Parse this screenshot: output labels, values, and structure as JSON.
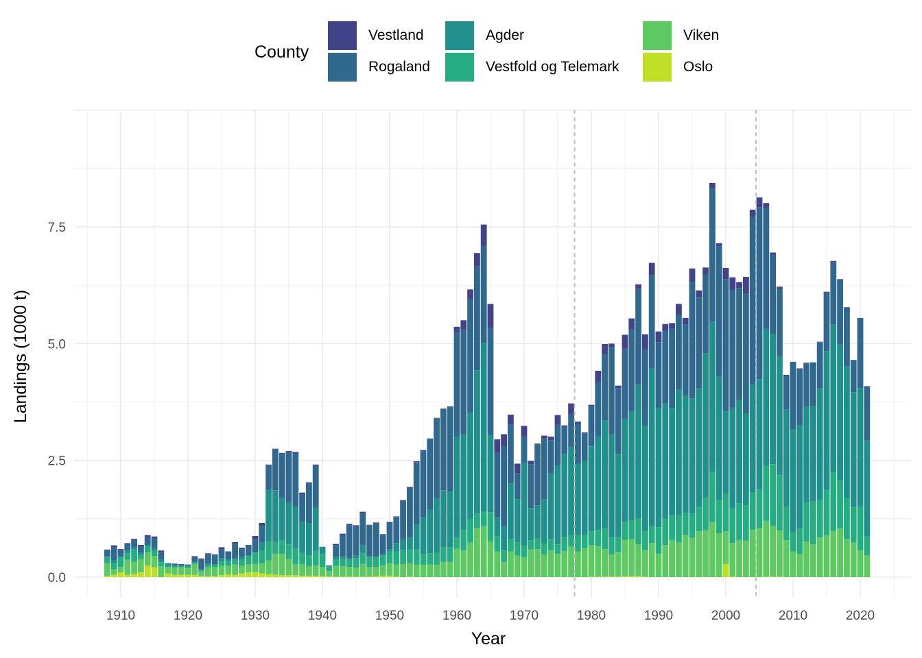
{
  "chart_data": {
    "type": "bar",
    "stacked": true,
    "title": "",
    "xlabel": "Year",
    "ylabel": "Landings (1000 t)",
    "ylim": [
      -0.35,
      9.6
    ],
    "xlim": [
      1903,
      2027
    ],
    "yticks": [
      0.0,
      2.5,
      5.0,
      7.5
    ],
    "ytick_labels": [
      "0.0",
      "2.5",
      "5.0",
      "7.5"
    ],
    "xticks": [
      1910,
      1920,
      1930,
      1940,
      1950,
      1960,
      1970,
      1980,
      1990,
      2000,
      2010,
      2020
    ],
    "xtick_labels": [
      "1910",
      "1920",
      "1930",
      "1940",
      "1950",
      "1960",
      "1970",
      "1980",
      "1990",
      "2000",
      "2010",
      "2020"
    ],
    "grid": true,
    "vlines": [
      1977.5,
      2004.5
    ],
    "legend": {
      "title": "County",
      "position": "top"
    },
    "series_order_bottom_to_top": [
      "Oslo",
      "Viken",
      "Vestfold og Telemark",
      "Agder",
      "Rogaland",
      "Vestland"
    ],
    "colors": {
      "Vestland": "#414487",
      "Rogaland": "#31688e",
      "Agder": "#21908c",
      "Vestfold og Telemark": "#27ad81",
      "Viken": "#5ec962",
      "Oslo": "#bddf26"
    },
    "x": [
      1908,
      1909,
      1910,
      1911,
      1912,
      1913,
      1914,
      1915,
      1916,
      1917,
      1918,
      1919,
      1920,
      1921,
      1922,
      1923,
      1924,
      1925,
      1926,
      1927,
      1928,
      1929,
      1930,
      1931,
      1932,
      1933,
      1934,
      1935,
      1936,
      1937,
      1938,
      1939,
      1940,
      1941,
      1942,
      1943,
      1944,
      1945,
      1946,
      1947,
      1948,
      1949,
      1950,
      1951,
      1952,
      1953,
      1954,
      1955,
      1956,
      1957,
      1958,
      1959,
      1960,
      1961,
      1962,
      1963,
      1964,
      1965,
      1966,
      1967,
      1968,
      1969,
      1970,
      1971,
      1972,
      1973,
      1974,
      1975,
      1976,
      1977,
      1978,
      1979,
      1980,
      1981,
      1982,
      1983,
      1984,
      1985,
      1986,
      1987,
      1988,
      1989,
      1990,
      1991,
      1992,
      1993,
      1994,
      1995,
      1996,
      1997,
      1998,
      1999,
      2000,
      2001,
      2002,
      2003,
      2004,
      2005,
      2006,
      2007,
      2008,
      2009,
      2010,
      2011,
      2012,
      2013,
      2014,
      2015,
      2016,
      2017,
      2018,
      2019,
      2020,
      2021
    ],
    "series": [
      {
        "name": "Oslo",
        "values": [
          0.03,
          0.05,
          0.1,
          0.05,
          0.07,
          0.1,
          0.25,
          0.21,
          0.0,
          0.08,
          0.05,
          0.05,
          0.05,
          0.05,
          0.02,
          0.02,
          0.02,
          0.04,
          0.06,
          0.05,
          0.08,
          0.1,
          0.1,
          0.08,
          0.06,
          0.05,
          0.04,
          0.04,
          0.04,
          0.03,
          0.03,
          0.03,
          0.02,
          0.02,
          0.01,
          0.01,
          0.01,
          0.01,
          0.01,
          0.01,
          0.02,
          0.03,
          0.03,
          0.01,
          0.0,
          0.01,
          0.0,
          0.0,
          0.0,
          0.0,
          0.0,
          0.0,
          0.0,
          0.0,
          0.0,
          0.0,
          0.0,
          0.0,
          0.0,
          0.0,
          0.0,
          0.0,
          0.0,
          0.0,
          0.0,
          0.0,
          0.0,
          0.0,
          0.0,
          0.0,
          0.0,
          0.0,
          0.01,
          0.01,
          0.01,
          0.01,
          0.01,
          0.02,
          0.02,
          0.02,
          0.01,
          0.0,
          0.0,
          0.0,
          0.0,
          0.0,
          0.0,
          0.0,
          0.0,
          0.0,
          0.0,
          0.0,
          0.28,
          0.01,
          0.0,
          0.0,
          0.0,
          0.0,
          0.01,
          0.01,
          0.01,
          0.0,
          0.0,
          0.0,
          0.0,
          0.0,
          0.0,
          0.0,
          0.0,
          0.0,
          0.0,
          0.0,
          0.0,
          0.0
        ]
      },
      {
        "name": "Viken",
        "values": [
          0.27,
          0.12,
          0.12,
          0.32,
          0.26,
          0.29,
          0.28,
          0.24,
          0.23,
          0.14,
          0.15,
          0.16,
          0.14,
          0.23,
          0.1,
          0.19,
          0.2,
          0.2,
          0.18,
          0.22,
          0.16,
          0.17,
          0.18,
          0.22,
          0.3,
          0.45,
          0.46,
          0.35,
          0.23,
          0.25,
          0.2,
          0.22,
          0.2,
          0.11,
          0.23,
          0.22,
          0.21,
          0.19,
          0.27,
          0.2,
          0.2,
          0.22,
          0.27,
          0.26,
          0.28,
          0.29,
          0.27,
          0.26,
          0.27,
          0.26,
          0.33,
          0.33,
          0.61,
          0.57,
          0.74,
          1.05,
          1.09,
          0.76,
          0.55,
          0.33,
          0.55,
          0.46,
          0.42,
          0.59,
          0.6,
          0.48,
          0.57,
          0.5,
          0.56,
          0.65,
          0.55,
          0.62,
          0.67,
          0.65,
          0.59,
          0.47,
          0.53,
          0.78,
          0.79,
          0.68,
          0.56,
          0.73,
          0.5,
          0.69,
          0.8,
          0.75,
          0.9,
          0.84,
          0.98,
          1.0,
          1.18,
          0.94,
          0.7,
          0.72,
          0.8,
          0.78,
          1.02,
          1.05,
          1.2,
          1.08,
          0.99,
          0.79,
          0.55,
          0.49,
          0.76,
          0.7,
          0.85,
          0.89,
          0.99,
          1.04,
          0.82,
          0.74,
          0.58,
          0.47
        ]
      },
      {
        "name": "Vestfold og Telemark",
        "values": [
          0.12,
          0.12,
          0.22,
          0.14,
          0.26,
          0.09,
          0.13,
          0.11,
          0.09,
          0.03,
          0.04,
          0.03,
          0.05,
          0.03,
          0.03,
          0.05,
          0.05,
          0.1,
          0.11,
          0.1,
          0.13,
          0.18,
          0.24,
          0.26,
          0.4,
          0.25,
          0.3,
          0.31,
          0.35,
          0.24,
          0.23,
          0.31,
          0.28,
          0.08,
          0.13,
          0.16,
          0.15,
          0.2,
          0.24,
          0.21,
          0.2,
          0.21,
          0.25,
          0.28,
          0.29,
          0.29,
          0.32,
          0.23,
          0.24,
          0.26,
          0.31,
          0.31,
          0.24,
          0.45,
          0.5,
          0.31,
          0.31,
          0.63,
          0.33,
          0.24,
          0.26,
          0.29,
          0.23,
          0.2,
          0.23,
          0.23,
          0.25,
          0.2,
          0.29,
          0.24,
          0.35,
          0.28,
          0.3,
          0.35,
          0.45,
          0.37,
          0.32,
          0.38,
          0.4,
          0.55,
          0.42,
          0.36,
          0.57,
          0.56,
          0.53,
          0.57,
          0.48,
          0.52,
          0.52,
          0.71,
          1.08,
          0.7,
          0.8,
          0.74,
          0.78,
          0.75,
          0.8,
          0.83,
          1.17,
          1.33,
          1.19,
          0.72,
          0.41,
          0.54,
          0.84,
          0.92,
          0.8,
          0.98,
          1.25,
          1.02,
          0.87,
          0.76,
          0.93,
          0.4
        ]
      },
      {
        "name": "Agder",
        "values": [
          0.03,
          0.07,
          0.0,
          0.06,
          0.05,
          0.04,
          0.03,
          0.05,
          0.05,
          0.05,
          0.01,
          0.0,
          0.0,
          0.02,
          0.02,
          0.03,
          0.0,
          0.07,
          0.04,
          0.03,
          0.06,
          0.02,
          0.02,
          0.18,
          1.11,
          1.11,
          0.89,
          0.89,
          0.89,
          0.67,
          0.69,
          0.93,
          0.15,
          0.02,
          0.07,
          0.06,
          0.03,
          0.06,
          0.16,
          0.03,
          0.02,
          0.03,
          0.05,
          0.18,
          0.24,
          0.26,
          0.53,
          0.79,
          0.93,
          1.17,
          1.22,
          1.2,
          2.15,
          2.04,
          2.28,
          3.07,
          3.61,
          1.65,
          0.4,
          0.52,
          1.2,
          0.92,
          1.8,
          0.69,
          0.71,
          0.96,
          1.4,
          1.7,
          1.78,
          1.9,
          1.53,
          1.59,
          1.82,
          2.0,
          2.31,
          2.21,
          1.78,
          2.21,
          2.33,
          2.87,
          2.25,
          3.38,
          2.55,
          2.47,
          2.29,
          2.69,
          2.5,
          2.47,
          2.54,
          3.08,
          3.21,
          2.66,
          1.77,
          2.14,
          2.21,
          1.97,
          2.3,
          2.36,
          2.94,
          2.79,
          2.53,
          2.08,
          2.21,
          2.22,
          2.05,
          2.04,
          2.4,
          2.97,
          3.17,
          2.93,
          2.82,
          2.46,
          2.54,
          2.06
        ]
      },
      {
        "name": "Rogaland",
        "values": [
          0.12,
          0.28,
          0.13,
          0.16,
          0.15,
          0.13,
          0.17,
          0.22,
          0.17,
          0.0,
          0.04,
          0.04,
          0.03,
          0.1,
          0.2,
          0.2,
          0.21,
          0.18,
          0.14,
          0.32,
          0.17,
          0.21,
          0.28,
          0.36,
          0.52,
          0.88,
          0.95,
          1.09,
          1.13,
          0.58,
          0.86,
          0.89,
          0.0,
          0.01,
          0.24,
          0.46,
          0.71,
          0.62,
          0.69,
          0.66,
          0.71,
          0.41,
          0.56,
          0.55,
          0.82,
          1.05,
          1.34,
          1.42,
          1.52,
          1.71,
          1.74,
          1.81,
          2.25,
          2.24,
          2.42,
          2.23,
          2.08,
          2.3,
          1.38,
          1.72,
          1.26,
          0.56,
          0.56,
          0.94,
          1.32,
          1.3,
          0.71,
          0.86,
          0.59,
          0.69,
          0.85,
          0.59,
          0.86,
          1.16,
          1.4,
          1.86,
          1.4,
          1.5,
          1.76,
          2.05,
          1.63,
          2.0,
          1.41,
          1.55,
          1.7,
          1.61,
          1.53,
          2.49,
          1.96,
          1.69,
          2.86,
          2.78,
          2.83,
          2.54,
          2.4,
          2.57,
          3.6,
          3.68,
          2.59,
          1.69,
          1.45,
          0.72,
          1.43,
          1.21,
          0.92,
          0.94,
          0.98,
          1.25,
          1.34,
          1.38,
          1.27,
          0.69,
          1.5,
          1.16
        ]
      },
      {
        "name": "Vestland",
        "values": [
          0.02,
          0.04,
          0.03,
          0.0,
          0.03,
          0.04,
          0.04,
          0.04,
          0.03,
          0.0,
          0.0,
          0.0,
          0.0,
          0.02,
          0.03,
          0.02,
          0.01,
          0.05,
          0.02,
          0.03,
          0.03,
          0.01,
          0.06,
          0.06,
          0.02,
          0.01,
          0.02,
          0.02,
          0.04,
          0.04,
          0.02,
          0.03,
          0.0,
          0.01,
          0.03,
          0.02,
          0.03,
          0.03,
          0.03,
          0.01,
          0.02,
          0.02,
          0.02,
          0.02,
          0.02,
          0.03,
          0.02,
          0.02,
          0.01,
          0.01,
          0.01,
          0.01,
          0.11,
          0.2,
          0.22,
          0.28,
          0.46,
          0.51,
          0.29,
          0.25,
          0.21,
          0.2,
          0.23,
          0.07,
          0.0,
          0.06,
          0.08,
          0.21,
          0.03,
          0.24,
          0.05,
          0.02,
          0.03,
          0.25,
          0.23,
          0.08,
          0.06,
          0.3,
          0.24,
          0.1,
          0.33,
          0.26,
          0.23,
          0.15,
          0.12,
          0.23,
          0.14,
          0.29,
          0.14,
          0.15,
          0.11,
          0.07,
          0.24,
          0.27,
          0.13,
          0.36,
          0.15,
          0.21,
          0.1,
          0.05,
          0.05,
          0.02,
          0.01,
          0.01,
          0.02,
          0.0,
          0.01,
          0.02,
          0.02,
          0.01,
          0.0,
          0.0,
          0.0,
          0.0
        ]
      }
    ]
  }
}
